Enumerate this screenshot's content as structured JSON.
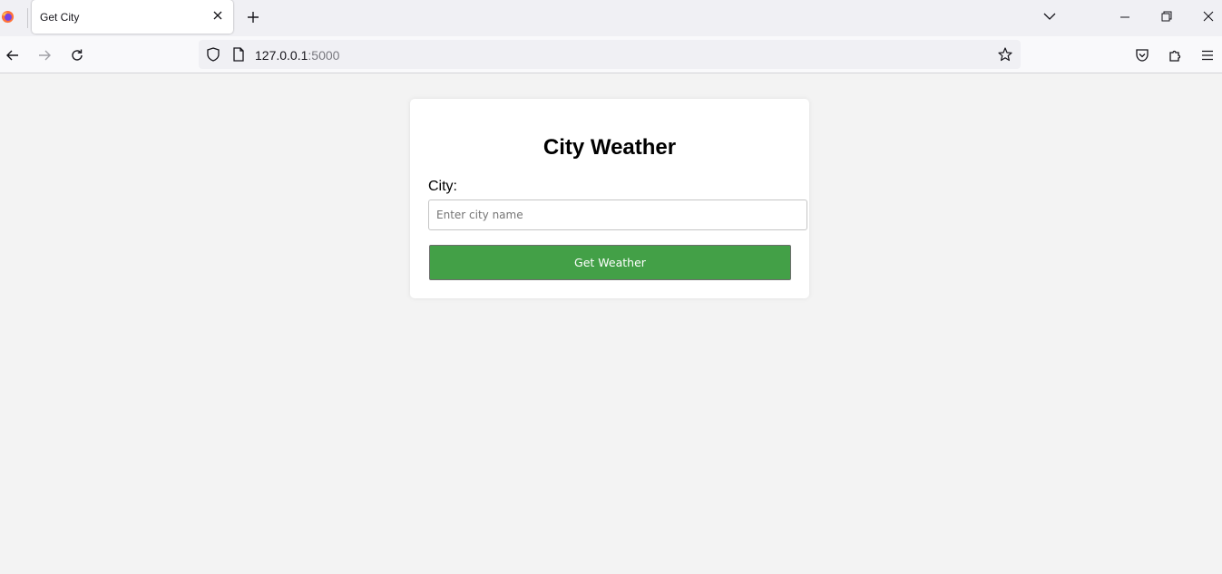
{
  "browser": {
    "tab_title": "Get City",
    "url_host": "127.0.0.1",
    "url_port": ":5000",
    "icons": {
      "logo": "firefox-logo-icon",
      "tab_close": "close-icon",
      "new_tab": "plus-icon",
      "tab_list": "chevron-down-icon",
      "minimize": "minimize-icon",
      "restore": "restore-icon",
      "window_close": "close-icon",
      "back": "arrow-left-icon",
      "forward": "arrow-right-icon",
      "reload": "reload-icon",
      "tracking_protection": "shield-icon",
      "page_info": "page-icon",
      "bookmark": "star-icon",
      "pocket": "pocket-icon",
      "extensions": "puzzle-icon",
      "menu": "hamburger-menu-icon"
    }
  },
  "page": {
    "title": "City Weather",
    "city_label": "City:",
    "city_input": {
      "value": "",
      "placeholder": "Enter city name"
    },
    "submit_label": "Get Weather",
    "colors": {
      "button": "#43a047",
      "background": "#f3f3f3",
      "card": "#ffffff"
    }
  }
}
